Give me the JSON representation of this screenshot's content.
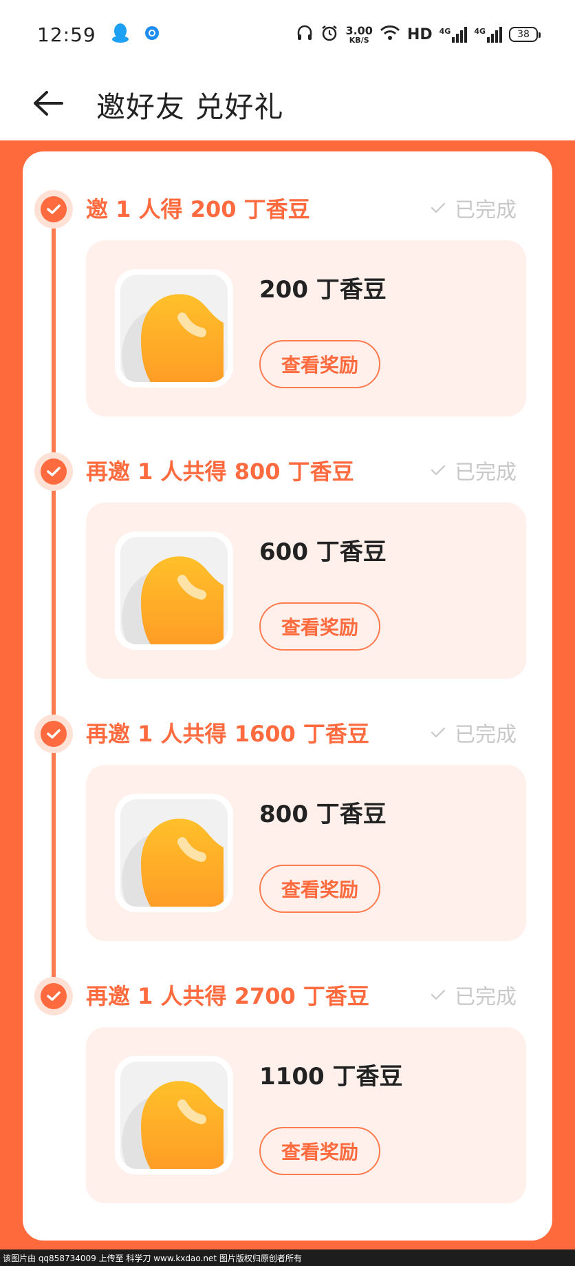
{
  "status_bar": {
    "time": "12:59",
    "net_speed_value": "3.00",
    "net_speed_unit": "KB/S",
    "hd_label": "HD",
    "signal_label_1": "4G",
    "signal_label_2": "4G",
    "battery": "38",
    "icons": [
      "qq-icon",
      "browser-icon",
      "headphones-icon",
      "alarm-icon",
      "wifi-icon",
      "signal-icon",
      "battery-icon"
    ]
  },
  "header": {
    "title": "邀好友 兑好礼",
    "back_icon": "arrow-left-icon"
  },
  "colors": {
    "accent": "#ff6b3e",
    "background": "#ff6a3d",
    "reward_bg": "#fff0eb",
    "done_gray": "#c8c8c8"
  },
  "steps": [
    {
      "title": "邀 1 人得 200 丁香豆",
      "status": "已完成",
      "reward": "200 丁香豆",
      "button": "查看奖励"
    },
    {
      "title": "再邀 1 人共得 800 丁香豆",
      "status": "已完成",
      "reward": "600 丁香豆",
      "button": "查看奖励"
    },
    {
      "title": "再邀 1 人共得 1600 丁香豆",
      "status": "已完成",
      "reward": "800 丁香豆",
      "button": "查看奖励"
    },
    {
      "title": "再邀 1 人共得 2700 丁香豆",
      "status": "已完成",
      "reward": "1100 丁香豆",
      "button": "查看奖励"
    }
  ],
  "watermark": "该图片由 qq858734009 上传至 科学刀 www.kxdao.net 图片版权归原创者所有"
}
